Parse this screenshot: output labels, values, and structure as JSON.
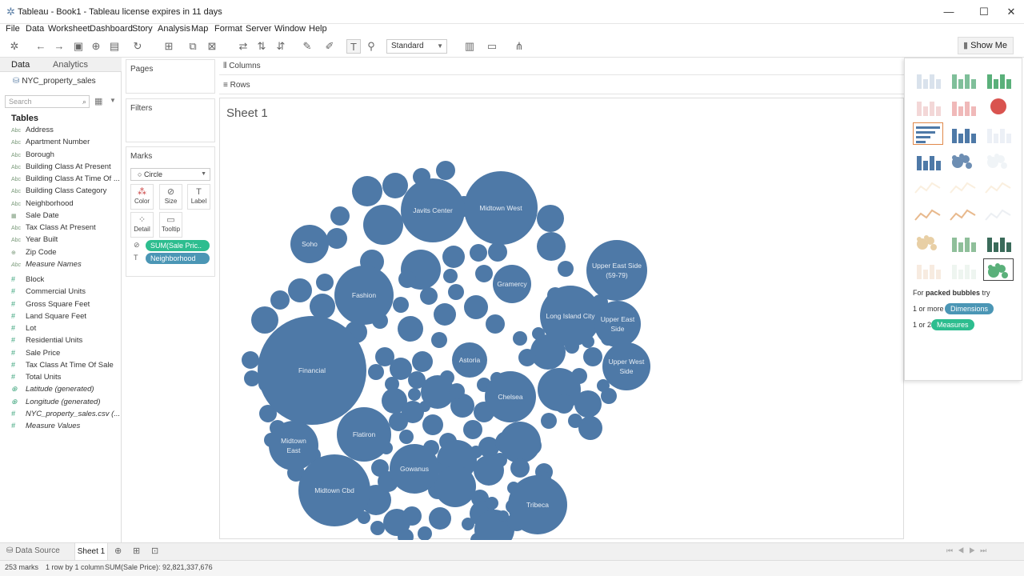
{
  "window": {
    "title": "Tableau - Book1 - Tableau license expires in 11 days"
  },
  "menu": [
    "File",
    "Data",
    "Worksheet",
    "Dashboard",
    "Story",
    "Analysis",
    "Map",
    "Format",
    "Server",
    "Window",
    "Help"
  ],
  "toolbar": {
    "standard_label": "Standard",
    "show_me_label": "Show Me"
  },
  "data_pane": {
    "tabs": [
      "Data",
      "Analytics"
    ],
    "datasource": "NYC_property_sales",
    "search_placeholder": "Search",
    "tables_heading": "Tables",
    "dimensions": [
      {
        "icon": "Abc",
        "label": "Address"
      },
      {
        "icon": "Abc",
        "label": "Apartment Number"
      },
      {
        "icon": "Abc",
        "label": "Borough"
      },
      {
        "icon": "Abc",
        "label": "Building Class At Present"
      },
      {
        "icon": "Abc",
        "label": "Building Class At Time Of ..."
      },
      {
        "icon": "Abc",
        "label": "Building Class Category"
      },
      {
        "icon": "Abc",
        "label": "Neighborhood"
      },
      {
        "icon": "cal",
        "label": "Sale Date"
      },
      {
        "icon": "Abc",
        "label": "Tax Class At Present"
      },
      {
        "icon": "Abc",
        "label": "Year Built"
      },
      {
        "icon": "globe",
        "label": "Zip Code"
      },
      {
        "icon": "Abc",
        "label": "Measure Names",
        "italic": true
      }
    ],
    "measures": [
      {
        "icon": "#",
        "label": "Block"
      },
      {
        "icon": "#",
        "label": "Commercial Units"
      },
      {
        "icon": "#",
        "label": "Gross Square Feet"
      },
      {
        "icon": "#",
        "label": "Land Square Feet"
      },
      {
        "icon": "#",
        "label": "Lot"
      },
      {
        "icon": "#",
        "label": "Residential Units"
      },
      {
        "icon": "#",
        "label": "Sale Price"
      },
      {
        "icon": "#",
        "label": "Tax Class At Time Of Sale"
      },
      {
        "icon": "#",
        "label": "Total Units"
      },
      {
        "icon": "globe",
        "label": "Latitude (generated)",
        "italic": true
      },
      {
        "icon": "globe",
        "label": "Longitude (generated)",
        "italic": true
      },
      {
        "icon": "#",
        "label": "NYC_property_sales.csv (...",
        "italic": true
      },
      {
        "icon": "#",
        "label": "Measure Values",
        "italic": true
      }
    ]
  },
  "shelves": {
    "pages_label": "Pages",
    "filters_label": "Filters",
    "marks_label": "Marks",
    "mark_type": "Circle",
    "mark_buttons": [
      "Color",
      "Size",
      "Label",
      "Detail",
      "Tooltip"
    ],
    "pills": [
      {
        "label": "SUM(Sale Pric..",
        "color": "#2dbd8f"
      },
      {
        "label": "Neighborhood",
        "color": "#4b96b5"
      }
    ],
    "columns_label": "Columns",
    "rows_label": "Rows"
  },
  "view": {
    "sheet_title": "Sheet 1"
  },
  "chart_data": {
    "type": "packed_bubbles",
    "measure": "SUM(Sale Price)",
    "dimension": "Neighborhood",
    "mark_count": 253,
    "color": "#4e79a7",
    "labeled_bubbles": [
      "Financial",
      "Midtown West",
      "Javits Center",
      "Soho",
      "Fashion",
      "Gramercy",
      "Upper East Side (59-79)",
      "Long Island City",
      "Upper East Side",
      "Upper West Side",
      "Astoria",
      "Chelsea",
      "Midtown East",
      "Flatiron",
      "Midtown Cbd",
      "Gowanus",
      "Tribeca"
    ]
  },
  "show_me": {
    "hint_prefix": "For ",
    "hint_chart": "packed bubbles",
    "hint_suffix": " try",
    "req1_prefix": "1 or more",
    "req1_pill": "Dimensions",
    "req2_prefix": "1 or 2",
    "req2_pill": "Measures",
    "dim_color": "#4b96b5",
    "measure_color": "#2dbd8f"
  },
  "sheet_tabs": {
    "data_source": "Data Source",
    "sheet": "Sheet 1"
  },
  "status": {
    "marks": "253 marks",
    "rows": "1 row by 1 column",
    "sum": "SUM(Sale Price): 92,821,337,676"
  }
}
